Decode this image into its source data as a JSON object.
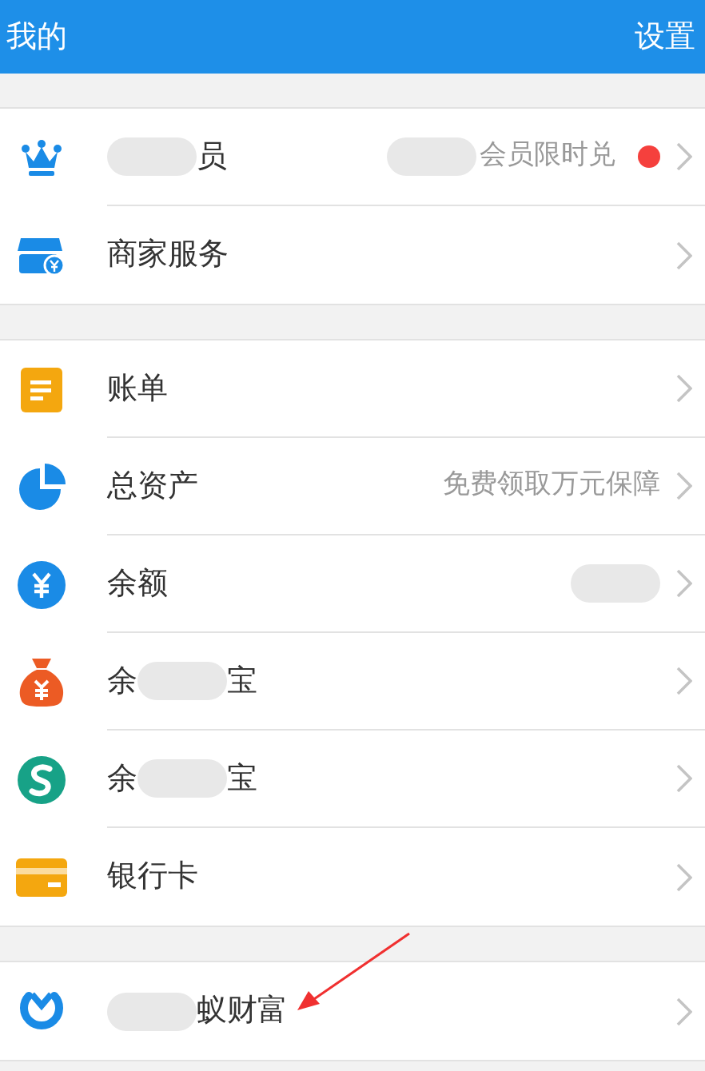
{
  "header": {
    "title": "我的",
    "action": "设置"
  },
  "sections": [
    {
      "rows": [
        {
          "label": [
            {
              "kind": "blur"
            },
            {
              "kind": "text",
              "text": "员"
            }
          ],
          "detail": [
            {
              "kind": "blur"
            },
            {
              "kind": "text",
              "text": "会员限时兑"
            }
          ],
          "notification_dot": true
        },
        {
          "label": [
            {
              "kind": "text",
              "text": "商家服务"
            }
          ],
          "detail": [],
          "notification_dot": false
        }
      ]
    },
    {
      "rows": [
        {
          "label": [
            {
              "kind": "text",
              "text": "账单"
            }
          ],
          "detail": [],
          "notification_dot": false
        },
        {
          "label": [
            {
              "kind": "text",
              "text": "总资产"
            }
          ],
          "detail": [
            {
              "kind": "text",
              "text": "免费领取万元保障"
            }
          ],
          "notification_dot": false
        },
        {
          "label": [
            {
              "kind": "text",
              "text": "余额"
            }
          ],
          "detail": [
            {
              "kind": "blur"
            }
          ],
          "notification_dot": false
        },
        {
          "label": [
            {
              "kind": "text",
              "text": "余"
            },
            {
              "kind": "blur"
            },
            {
              "kind": "text",
              "text": "宝"
            }
          ],
          "detail": [],
          "notification_dot": false
        },
        {
          "label": [
            {
              "kind": "text",
              "text": "余"
            },
            {
              "kind": "blur"
            },
            {
              "kind": "text",
              "text": "宝"
            }
          ],
          "detail": [],
          "notification_dot": false
        },
        {
          "label": [
            {
              "kind": "text",
              "text": "银行卡"
            }
          ],
          "detail": [],
          "notification_dot": false
        }
      ]
    },
    {
      "rows": [
        {
          "label": [
            {
              "kind": "blur"
            },
            {
              "kind": "text",
              "text": "蚁财富"
            }
          ],
          "detail": [],
          "notification_dot": false
        }
      ]
    }
  ]
}
